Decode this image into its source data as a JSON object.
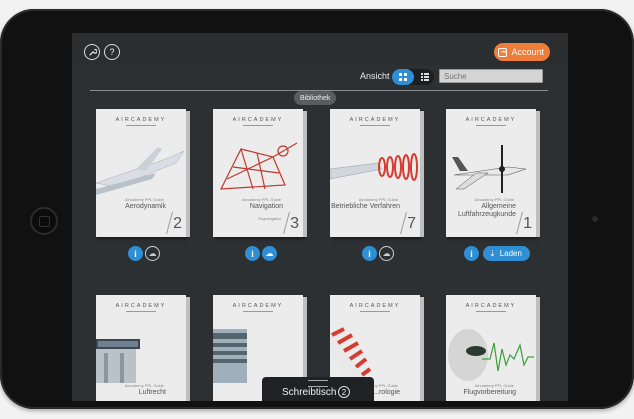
{
  "header": {
    "settings_icon": "wrench-icon",
    "help_label": "?",
    "account_label": "Account"
  },
  "toolbar": {
    "ansicht_label": "Ansicht",
    "grid_icon": "grid-icon",
    "list_icon": "list-icon",
    "search_placeholder": "Suche"
  },
  "section": {
    "label": "Bibliothek"
  },
  "books": [
    {
      "brand": "AIRCADEMY",
      "tag": "Aircademy PPL Guide",
      "title": "Aerodynamik",
      "number": "2",
      "art": "airplane-wing",
      "state": "downloadable",
      "color": "#ffffff"
    },
    {
      "brand": "AIRCADEMY",
      "tag": "Aircademy PPL Guide",
      "title": "Navigation",
      "subtitle": "Flugnavigation",
      "number": "3",
      "art": "red-structure",
      "state": "downloaded",
      "color": "#ffffff"
    },
    {
      "brand": "AIRCADEMY",
      "tag": "Aircademy PPL Guide",
      "title": "Betriebliche Verfahren",
      "number": "7",
      "art": "red-spiral-wing",
      "state": "downloadable",
      "color": "#ffffff"
    },
    {
      "brand": "AIRCADEMY",
      "tag": "Aircademy PPL Guide",
      "title": "Allgemeine Luftfahrzeugkunde",
      "number": "1",
      "art": "propeller-aircraft",
      "state": "loading",
      "color": "#ffffff"
    },
    {
      "brand": "AIRCADEMY",
      "tag": "Aircademy PPL Guide",
      "title": "Luftrecht",
      "number": "",
      "art": "control-tower",
      "state": "",
      "color": "#ffffff"
    },
    {
      "brand": "AIRCADEMY",
      "tag": "",
      "title": "",
      "number": "",
      "art": "tower-building",
      "state": "",
      "color": "#ffffff"
    },
    {
      "brand": "AIRCADEMY",
      "tag": "Aircademy PPL Guide",
      "title": "...rologie",
      "number": "",
      "art": "windsock",
      "state": "",
      "color": "#ffffff"
    },
    {
      "brand": "AIRCADEMY",
      "tag": "Aircademy PPL Guide",
      "title": "Flugvorbereitung",
      "number": "",
      "art": "face-heartbeat",
      "state": "",
      "color": "#ffffff"
    }
  ],
  "actions": {
    "info_label": "i",
    "load_label": "Laden"
  },
  "footer": {
    "desk_label": "Schreibtisch",
    "desk_count": "2"
  },
  "colors": {
    "accent": "#2f8fd2",
    "account": "#ef7d3a",
    "background": "#2d3033"
  }
}
